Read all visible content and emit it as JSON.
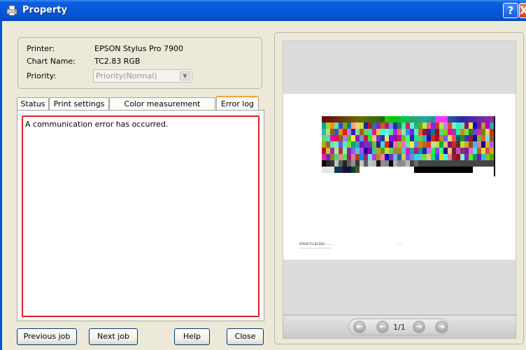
{
  "window": {
    "title": "Property",
    "help_button": "?",
    "close_button": "X"
  },
  "info": {
    "printer_label": "Printer:",
    "printer_value": "EPSON Stylus Pro 7900",
    "chart_label": "Chart Name:",
    "chart_value": "TC2.83 RGB",
    "priority_label": "Priority:",
    "priority_value": "Priority(Normal)"
  },
  "tabs": [
    {
      "label": "Status"
    },
    {
      "label": "Print settings"
    },
    {
      "label": "Color measurement settings"
    },
    {
      "label": "Error log",
      "active": true
    }
  ],
  "error_log": {
    "text": "A communication error has occurred."
  },
  "buttons": {
    "previous_job": "Previous job",
    "next_job": "Next job",
    "help": "Help",
    "close": "Close"
  },
  "preview": {
    "page_indicator": "1/1",
    "fine_print_1": "EPSON TC2.83 RGB  ...........",
    "fine_print_2": "...........................................",
    "fine_print_3": "......"
  },
  "colors": {
    "titlebar": "#0558d8",
    "error_border": "#e0202a",
    "active_tab": "#f3a33d"
  }
}
